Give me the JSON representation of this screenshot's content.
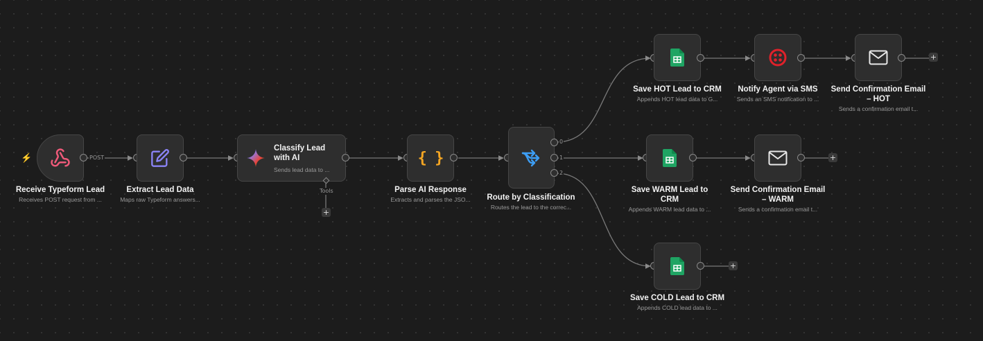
{
  "canvas": {
    "background": "#1c1c1c"
  },
  "nodes": {
    "receive": {
      "title": "Receive Typeform Lead",
      "subtitle": "Receives POST request from ...",
      "icon": "webhook-icon",
      "accent": "#ef5a7a"
    },
    "extract": {
      "title": "Extract Lead Data",
      "subtitle": "Maps raw Typeform answers...",
      "icon": "pencil-edit-icon",
      "accent": "#8b84f7"
    },
    "classify": {
      "title": "Classify Lead with AI",
      "title_line1": "Classify Lead",
      "title_line2": "with AI",
      "subtitle": "Sends lead data to ...",
      "icon": "gemini-sparkle-icon",
      "tools_label": "Tools"
    },
    "parse": {
      "title": "Parse AI Response",
      "subtitle": "Extracts and parses the JSO...",
      "icon": "code-braces-icon",
      "accent": "#f5a623"
    },
    "route": {
      "title": "Route by Classification",
      "subtitle": "Routes the lead to the correc...",
      "icon": "switch-route-icon",
      "accent": "#3d9ef5",
      "outputs": [
        "0",
        "1",
        "2"
      ]
    },
    "save_hot": {
      "title": "Save HOT Lead to CRM",
      "subtitle": "Appends HOT lead data to G...",
      "icon": "google-sheets-icon"
    },
    "notify_sms": {
      "title": "Notify Agent via SMS",
      "subtitle": "Sends an SMS notification to ...",
      "icon": "twilio-icon",
      "accent": "#e0212a"
    },
    "email_hot": {
      "title": "Send Confirmation Email – HOT",
      "title_line1": "Send Confirmation Email",
      "title_line2": "– HOT",
      "subtitle": "Sends a confirmation email t...",
      "icon": "mail-envelope-icon"
    },
    "save_warm": {
      "title": "Save WARM Lead to CRM",
      "title_line1": "Save WARM Lead to",
      "title_line2": "CRM",
      "subtitle": "Appends WARM lead data to ...",
      "icon": "google-sheets-icon"
    },
    "email_warm": {
      "title": "Send Confirmation Email – WARM",
      "title_line1": "Send Confirmation Email",
      "title_line2": "– WARM",
      "subtitle": "Sends a confirmation email t...",
      "icon": "mail-envelope-icon"
    },
    "save_cold": {
      "title": "Save COLD Lead to CRM",
      "subtitle": "Appends COLD lead data to ...",
      "icon": "google-sheets-icon"
    }
  },
  "edges": {
    "post_label": "POST"
  },
  "add_button_symbol": "+",
  "colors": {
    "sheets_green": "#1fa463",
    "wire": "#7a7a7a",
    "node_bg": "#2e2e2e"
  }
}
